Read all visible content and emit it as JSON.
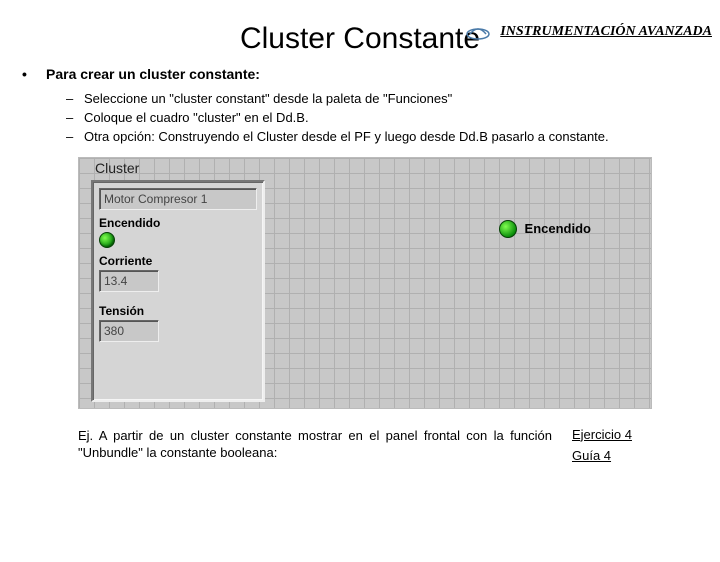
{
  "brand": "INSTRUMENTACIÓN AVANZADA",
  "title": "Cluster Constante",
  "main_bullet": "Para crear un cluster constante:",
  "sub_items": [
    "Seleccione un \"cluster constant\" desde la paleta de \"Funciones\"",
    "Coloque el cuadro \"cluster\" en el Dd.B.",
    "Otra opción: Construyendo el Cluster desde el PF y luego desde Dd.B pasarlo a constante."
  ],
  "cluster": {
    "title": "Cluster",
    "name_value": "Motor Compresor 1",
    "bool_label": "Encendido",
    "corriente_label": "Corriente",
    "corriente_value": "13.4",
    "tension_label": "Tensión",
    "tension_value": "380"
  },
  "output_label": "Encendido",
  "footer_text": "Ej. A partir de un cluster constante mostrar en el panel frontal con la función \"Unbundle\" la constante booleana:",
  "link1": "Ejercicio 4",
  "link2": "Guía 4"
}
